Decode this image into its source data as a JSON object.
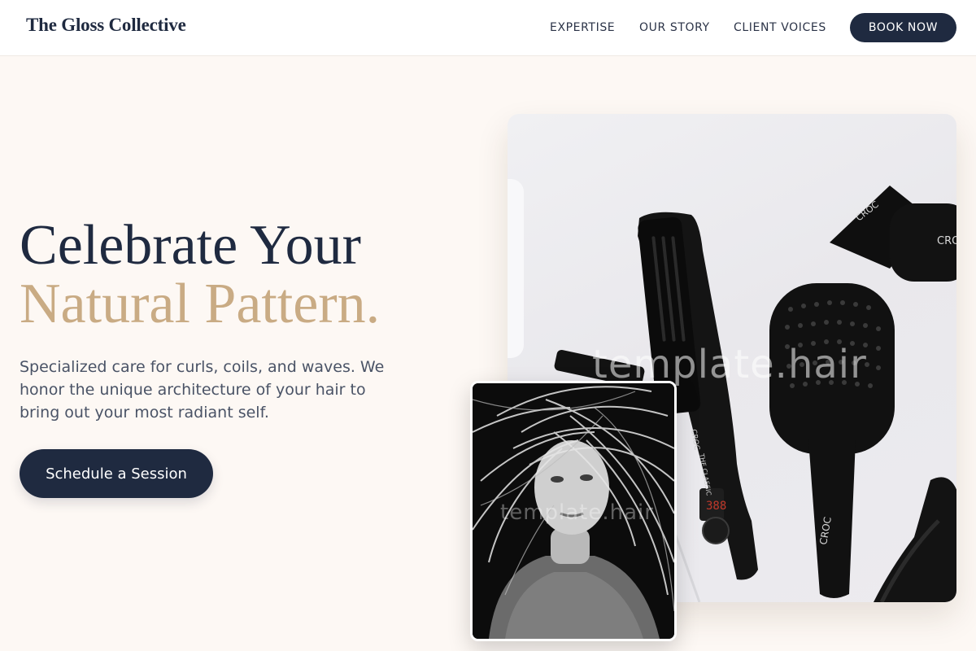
{
  "header": {
    "logo": "The Gloss Collective",
    "nav": [
      "EXPERTISE",
      "OUR STORY",
      "CLIENT VOICES"
    ],
    "book_label": "BOOK NOW"
  },
  "hero": {
    "headline_line1": "Celebrate Your",
    "headline_line2": "Natural Pattern.",
    "subtext": "Specialized care for curls, coils, and waves. We honor the unique architecture of your hair to bring out your most radiant self.",
    "cta_label": "Schedule a Session"
  },
  "images": {
    "main_watermark": "template.hair",
    "inset_watermark": "template.hair",
    "brand_marks": [
      "CROC",
      "CROC",
      "CROC",
      "CROC",
      "THE CLASSIC",
      "388"
    ]
  },
  "colors": {
    "navy": "#1f2a40",
    "gold": "#c9ab84",
    "cream": "#fdf8f4"
  }
}
